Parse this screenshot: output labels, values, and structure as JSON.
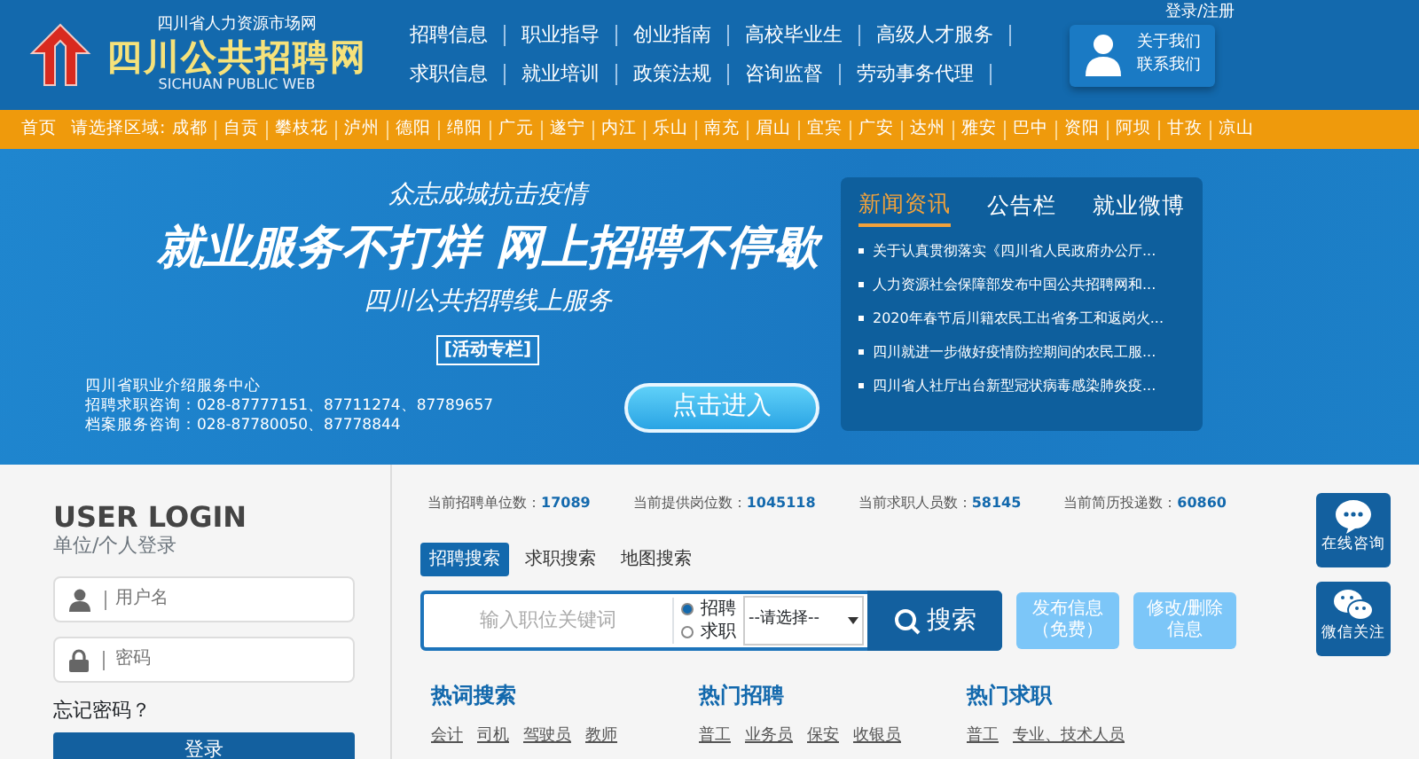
{
  "header": {
    "logo_subtitle": "四川省人力资源市场网",
    "logo_title": "四川公共招聘网",
    "logo_english": "SICHUAN PUBLIC WEB",
    "nav_rows": [
      [
        "招聘信息",
        "职业指导",
        "创业指南",
        "高校毕业生",
        "高级人才服务"
      ],
      [
        "求职信息",
        "就业培训",
        "政策法规",
        "咨询监督",
        "劳动事务代理"
      ]
    ],
    "contact": [
      "关于我们",
      "联系我们"
    ],
    "login_link": "登录/注册"
  },
  "region_bar": {
    "home": "首页",
    "label": "请选择区域:",
    "regions": [
      "成都",
      "自贡",
      "攀枝花",
      "泸州",
      "德阳",
      "绵阳",
      "广元",
      "遂宁",
      "内江",
      "乐山",
      "南充",
      "眉山",
      "宜宾",
      "广安",
      "达州",
      "雅安",
      "巴中",
      "资阳",
      "阿坝",
      "甘孜",
      "凉山"
    ]
  },
  "banner": {
    "slogan": "众志成城抗击疫情",
    "headline": "就业服务不打烊 网上招聘不停歇",
    "subline": "四川公共招聘线上服务",
    "tag": "[活动专栏]",
    "contact_lines": [
      "四川省职业介绍服务中心",
      "招聘求职咨询：028-87777151、87711274、87789657",
      "档案服务咨询：028-87780050、87778844"
    ],
    "enter_button": "点击进入"
  },
  "news": {
    "tabs": [
      {
        "label": "新闻资讯",
        "selected": true
      },
      {
        "label": "公告栏",
        "selected": false
      },
      {
        "label": "就业微博",
        "selected": false
      }
    ],
    "items": [
      "关于认真贯彻落实《四川省人民政府办公厅...",
      "人力资源社会保障部发布中国公共招聘网和...",
      "2020年春节后川籍农民工出省务工和返岗火...",
      "四川就进一步做好疫情防控期间的农民工服...",
      "四川省人社厅出台新型冠状病毒感染肺炎疫..."
    ]
  },
  "login": {
    "title": "USER LOGIN",
    "subtitle": "单位/个人登录",
    "username_placeholder": "用户名",
    "password_placeholder": "密码",
    "forgot": "忘记密码？",
    "submit": "登录"
  },
  "stats": [
    {
      "label": "当前招聘单位数：",
      "value": "17089"
    },
    {
      "label": "当前提供岗位数：",
      "value": "1045118"
    },
    {
      "label": "当前求职人员数：",
      "value": "58145"
    },
    {
      "label": "当前简历投递数：",
      "value": "60860"
    }
  ],
  "search_tabs": [
    {
      "label": "招聘搜索",
      "selected": true
    },
    {
      "label": "求职搜索",
      "selected": false
    },
    {
      "label": "地图搜索",
      "selected": false
    }
  ],
  "search": {
    "placeholder": "输入职位关键词",
    "radios": [
      {
        "label": "招聘",
        "selected": true
      },
      {
        "label": "求职",
        "selected": false
      }
    ],
    "select": "--请选择--",
    "button": "搜索"
  },
  "actions": [
    "发布信息（免费）",
    "修改/删除信息"
  ],
  "hot": [
    {
      "title": "热词搜索",
      "words": [
        "会计",
        "司机",
        "驾驶员",
        "教师"
      ]
    },
    {
      "title": "热门招聘",
      "words": [
        "普工",
        "业务员",
        "保安",
        "收银员"
      ]
    },
    {
      "title": "热门求职",
      "words": [
        "普工",
        "专业、技术人员"
      ]
    }
  ],
  "side_buttons": [
    {
      "kind": "chat",
      "label": "在线咨询"
    },
    {
      "kind": "wechat",
      "label": "微信关注"
    }
  ]
}
